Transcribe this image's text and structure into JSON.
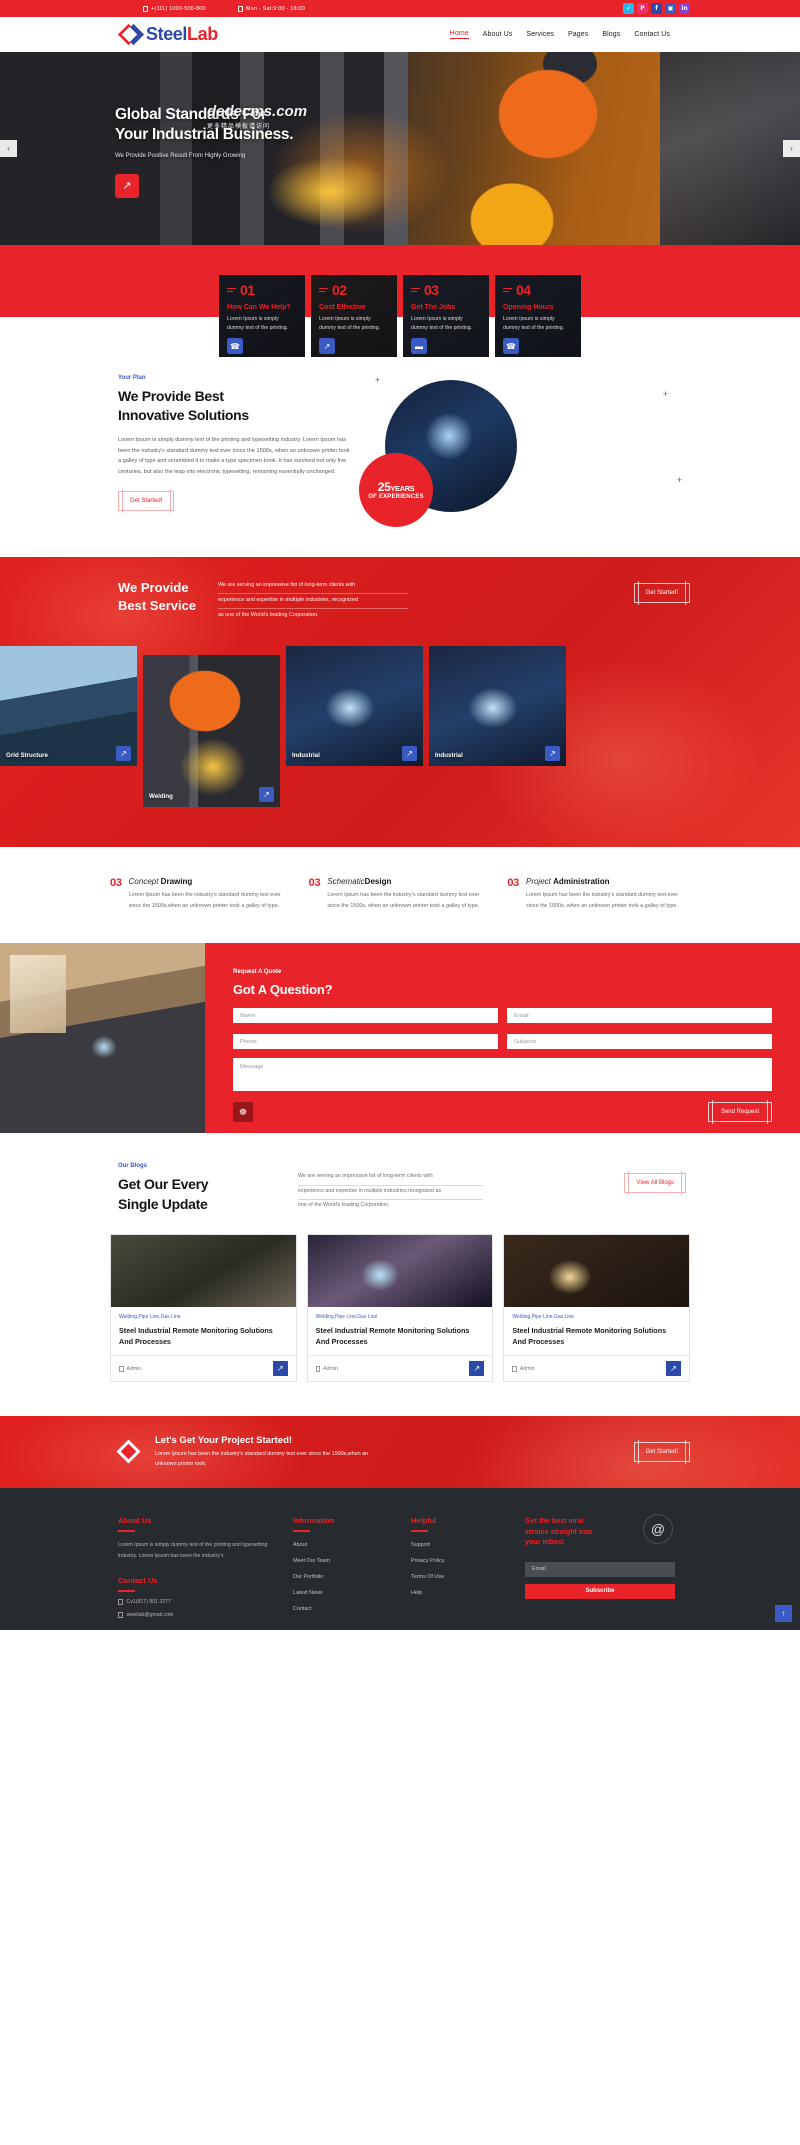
{
  "topbar": {
    "phone": "+(111) 1000-500-800",
    "hours": "Mon - Sat:9:00 - 18:00",
    "socials": [
      {
        "name": "twitter-icon",
        "glyph": "✓",
        "color": "#29b6e8"
      },
      {
        "name": "pinterest-icon",
        "glyph": "P",
        "color": "#e8326a"
      },
      {
        "name": "facebook-icon",
        "glyph": "f",
        "color": "#2b49a8"
      },
      {
        "name": "instagram-icon",
        "glyph": "▣",
        "color": "#3b5bc4"
      },
      {
        "name": "linkedin-icon",
        "glyph": "in",
        "color": "#8a3fd1"
      }
    ]
  },
  "header": {
    "logo_first": "Steel",
    "logo_second": "Lab",
    "nav": [
      {
        "label": "Home",
        "active": true
      },
      {
        "label": "About Us",
        "active": false
      },
      {
        "label": "Services",
        "active": false
      },
      {
        "label": "Pages",
        "active": false
      },
      {
        "label": "Blogs",
        "active": false
      },
      {
        "label": "Contact Us",
        "active": false
      }
    ]
  },
  "hero": {
    "title_line1": "Global Standards For",
    "title_line2": "Your Industrial Business.",
    "subtitle": "We Provide Positive Result From Highly Growing",
    "watermark_line1": "dedecms.com",
    "watermark_line2": "更多精品模板请访问",
    "button_icon": "arrow-icon",
    "prev_label": "‹",
    "next_label": "›"
  },
  "feature_cards": [
    {
      "num": "01",
      "title": "How Can We Help?",
      "text": "Lorem Ipsum is simply dummy text of the printing.",
      "icon": "phone-icon",
      "glyph": "☎"
    },
    {
      "num": "02",
      "title": "Cost Effective",
      "text": "Lorem Ipsum is simply dummy text of the printing.",
      "icon": "growth-arrow-icon",
      "glyph": "↗"
    },
    {
      "num": "03",
      "title": "Get The Jobs",
      "text": "Lorem Ipsum is simply dummy text of the printing.",
      "icon": "briefcase-icon",
      "glyph": "▬"
    },
    {
      "num": "04",
      "title": "Opening Hours",
      "text": "Lorem Ipsum is simply dummy text of the printing.",
      "icon": "phone-icon",
      "glyph": "☎"
    }
  ],
  "plan": {
    "eyebrow": "Your Plan",
    "title_line1": "We Provide Best",
    "title_line2": "Innovative Solutions",
    "paragraph": "Lorem Ipsum is simply dummy text of the printing and typesetting industry. Lorem Ipsum has been the industry's standard dummy text ever since the 1500s, when an unknown printer took a galley of type and scrambled it to make a type specimen book. It has survived not only five centuries, but also the leap into electronic typesetting, remaining essentially unchanged.",
    "button": "Get Started!",
    "badge_number": "25",
    "badge_years": "YEARS",
    "badge_sub": "OF EXPERIENCES"
  },
  "service": {
    "title_line1": "We Provide",
    "title_line2": "Best Service",
    "desc_line1": "We are serving an impressive list of long-term clients with",
    "desc_line2": "experience and expertise in multiple industries, recognized",
    "desc_line3": "as one of the World's leading Corporation.",
    "button": "Get Started!",
    "gallery": [
      {
        "label": "Grid Structure",
        "icon": "arrow-icon"
      },
      {
        "label": "Welding",
        "icon": "arrow-icon"
      },
      {
        "label": "Industrial",
        "icon": "arrow-icon"
      },
      {
        "label": "Industrial",
        "icon": "arrow-icon"
      }
    ]
  },
  "features": [
    {
      "num": "03",
      "title_italic": "Concept ",
      "title_bold": "Drawing",
      "text": "Lorem Ipsum has been the industry's standard dummy text ever since the 1500s,when an unknown printer took a galley of type."
    },
    {
      "num": "03",
      "title_italic": "Schematic",
      "title_bold": "Design",
      "text": "Lorem Ipsum has been the industry's standard dummy text ever since the 1500s, when an unknown printer took a galley of type."
    },
    {
      "num": "03",
      "title_italic": "Project ",
      "title_bold": "Administration",
      "text": "Lorem Ipsum has been the industry's standard dummy text ever since the 1500s, when an unknown printer took a galley of type."
    }
  ],
  "quote": {
    "eyebrow": "Request A Quote",
    "title": "Got A Question?",
    "name_placeholder": "Name",
    "email_placeholder": "Email",
    "phone_placeholder": "Phone",
    "subject_placeholder": "Subjects",
    "message_placeholder": "Message",
    "icon": "globe-icon",
    "send_label": "Send Request"
  },
  "blogs": {
    "eyebrow": "Our Blogs",
    "title_line1": "Get Our Every",
    "title_line2": "Single Update",
    "desc_line1": "We are serving an impressive list of long-term clients with",
    "desc_line2": "experience and expertise in multiple industries,recognized as",
    "desc_line3": "one of the World's leading Corporation.",
    "view_all": "View All Blogs",
    "posts": [
      {
        "tags": "Welding,Pipe Line,Gas Line",
        "title": "Steel Industrial Remote Monitoring Solutions And Processes",
        "author": "Admin",
        "icon": "arrow-icon"
      },
      {
        "tags": "Welding,Pipe Line,Gas Line",
        "title": "Steel Industrial Remote Monitoring Solutions And Processes",
        "author": "Admin",
        "icon": "arrow-icon"
      },
      {
        "tags": "Welding,Pipe Line,Gas Line",
        "title": "Steel Industrial Remote Monitoring Solutions And Processes",
        "author": "Admin",
        "icon": "arrow-icon"
      }
    ]
  },
  "cta": {
    "title": "Let's Get Your Project Started!",
    "text": "Lorem Ipsum has been the industry's standard dummy text ever since the 1500s,when an unknown printer took.",
    "button": "Get Started!"
  },
  "footer": {
    "about_head": "About Us",
    "about_text": "Lorem Ipsum is simply dummy text of the printing and typesetting industry. Lorem Ipsum has been the industry's",
    "contact_head": "Contact Us",
    "contact_phone": "Cv1(817) 901 2277",
    "contact_email": "steellab@gmail.com",
    "info_head": "Information",
    "info_links": [
      "About",
      "Meet Our Team",
      "Our Portfolio",
      "Latest News",
      "Contact"
    ],
    "helpful_head": "Helpful",
    "helpful_links": [
      "Support",
      "Privacy Policy",
      "Terms Of Use",
      "Help"
    ],
    "news_head_line1": "Get the best viral",
    "news_head_line2": "stroies straight into",
    "news_head_line3": "your inbox!",
    "at_icon": "at-icon",
    "email_placeholder": "Email",
    "subscribe_label": "Subscribe",
    "to_top_icon": "arrow-up-icon"
  },
  "colors": {
    "red": "#e8242a",
    "blue": "#2b49a8",
    "dark": "#272a2e"
  }
}
